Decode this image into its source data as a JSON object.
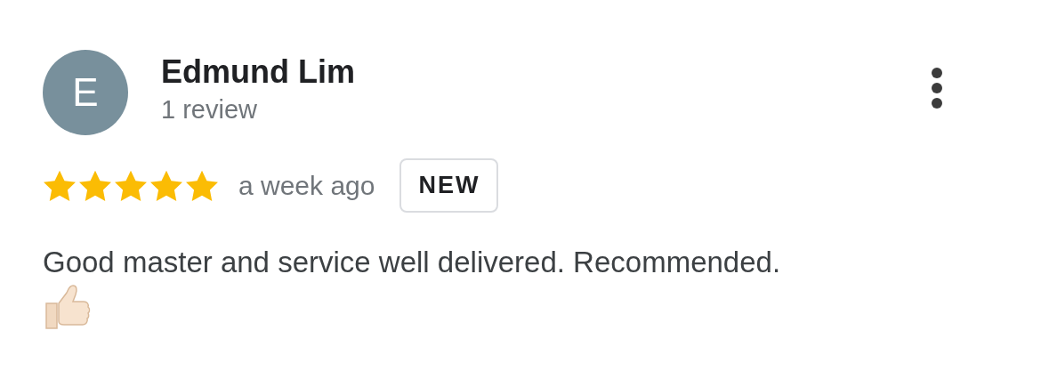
{
  "review": {
    "avatar": {
      "letter": "E",
      "color": "#78909c"
    },
    "name": "Edmund Lim",
    "review_count": "1 review",
    "stars": 5,
    "time": "a week ago",
    "badge": "NEW",
    "text": "Good master and service well delivered. Recommended.",
    "reaction": {
      "kind": "thumbs-up"
    }
  }
}
